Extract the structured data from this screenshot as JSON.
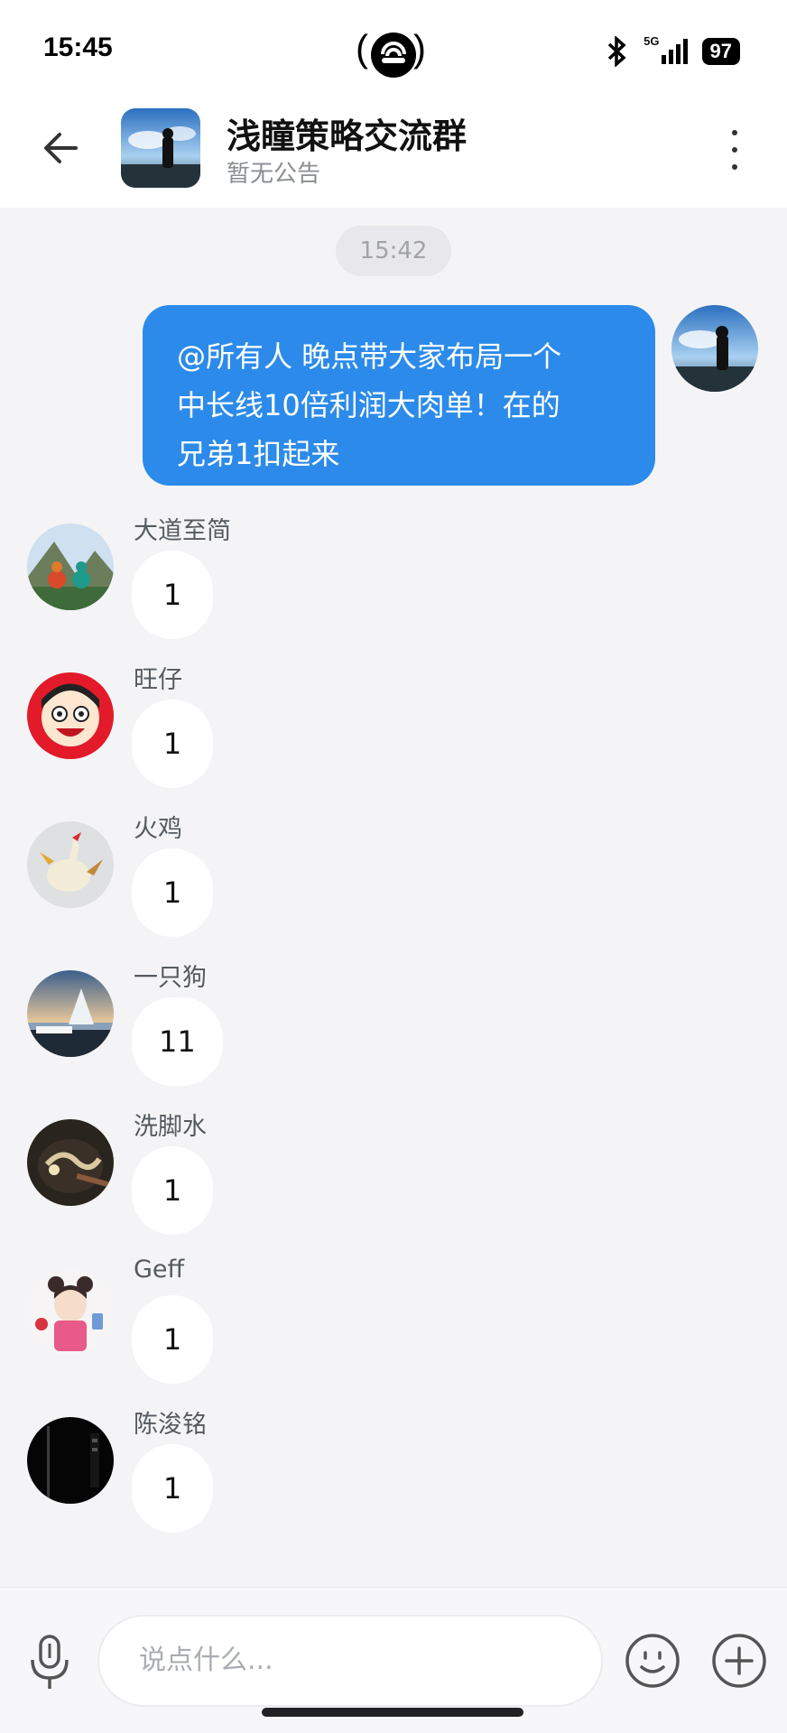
{
  "status_bar": {
    "time": "15:45",
    "network": "5G",
    "battery": "97"
  },
  "header": {
    "title": "浅瞳策略交流群",
    "subtitle": "暂无公告",
    "back_icon": "back-arrow-icon",
    "menu_icon": "more-vertical-icon"
  },
  "timestamp": "15:42",
  "outgoing_message": {
    "lines": [
      "@所有人 晚点带大家布局一个",
      "中长线10倍利润大肉单！在的",
      "兄弟1扣起来"
    ],
    "bubble_color": "#2c8bea"
  },
  "messages": [
    {
      "name": "大道至简",
      "text": "1"
    },
    {
      "name": "旺仔",
      "text": "1"
    },
    {
      "name": "火鸡",
      "text": "1"
    },
    {
      "name": "一只狗",
      "text": "11"
    },
    {
      "name": "洗脚水",
      "text": "1"
    },
    {
      "name": "Geff",
      "text": "1"
    },
    {
      "name": "陈浚铭",
      "text": "1"
    }
  ],
  "input": {
    "placeholder": "说点什么...",
    "voice_icon": "microphone-icon",
    "emoji_icon": "emoji-icon",
    "plus_icon": "plus-circle-icon"
  }
}
